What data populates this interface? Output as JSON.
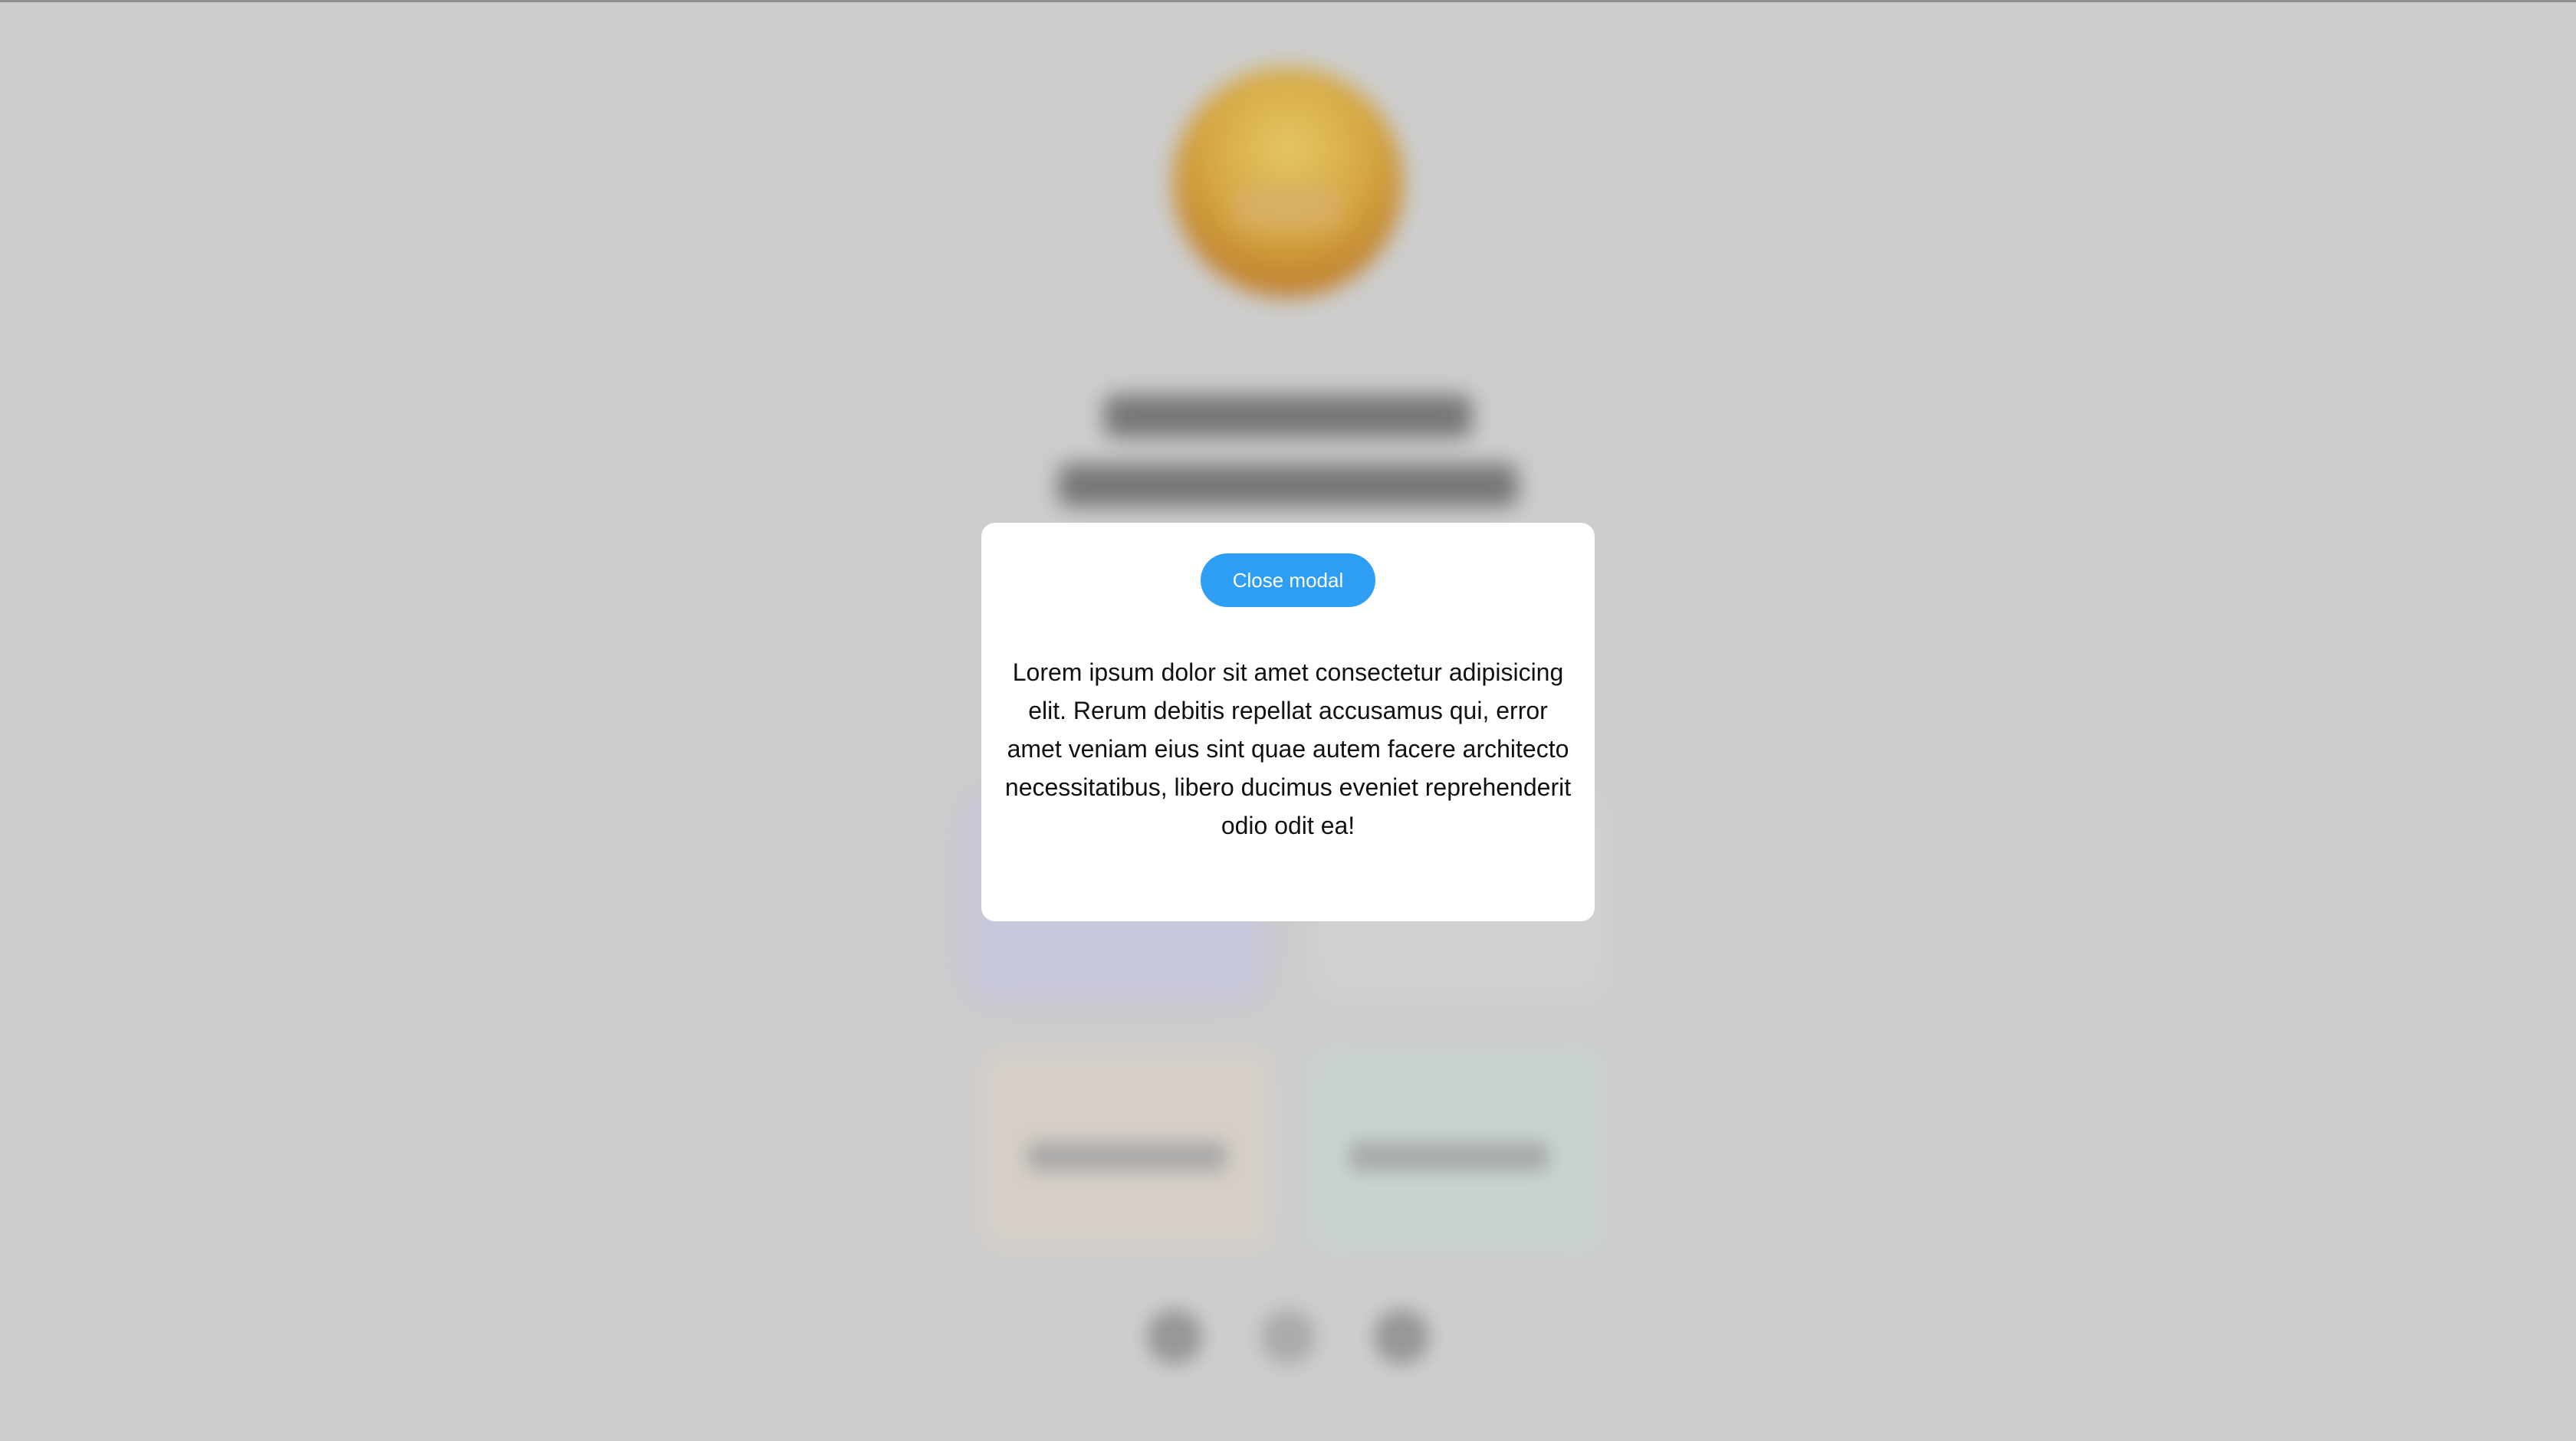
{
  "modal": {
    "close_button_label": "Close modal",
    "body_text": "Lorem ipsum dolor sit amet consectetur adipisicing elit. Rerum debitis repellat accusamus qui, error amet veniam eius sint quae autem facere architecto necessitatibus, libero ducimus eveniet reprehenderit odio odit ea!"
  },
  "colors": {
    "backdrop": "#cdcdcd",
    "modal_background": "#ffffff",
    "button_background": "#2e9ef5",
    "button_text": "#ffffff",
    "body_text": "#111111"
  },
  "icons": {
    "social": [
      "social-icon",
      "social-icon",
      "social-icon"
    ]
  }
}
